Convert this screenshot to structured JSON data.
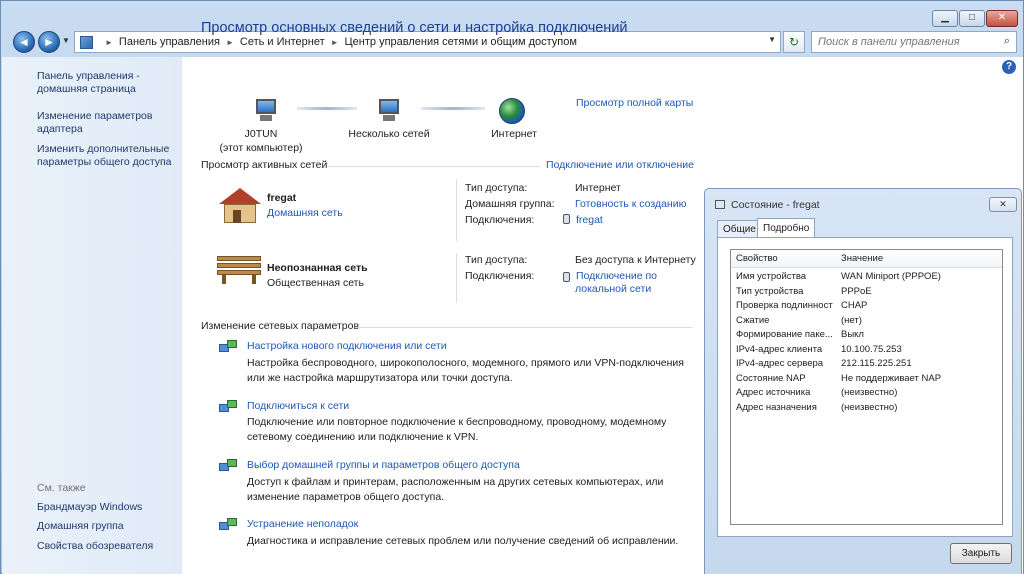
{
  "window": {
    "caption_buttons": {
      "minimize": "▁",
      "maximize": "□",
      "close": "✕"
    }
  },
  "navbar": {
    "back": "◄",
    "forward": "►",
    "breadcrumb": [
      "Панель управления",
      "Сеть и Интернет",
      "Центр управления сетями и общим доступом"
    ],
    "search_placeholder": "Поиск в панели управления"
  },
  "sidebar": {
    "items": [
      "Панель управления - домашняя страница",
      "Изменение параметров адаптера",
      "Изменить дополнительные параметры общего доступа"
    ],
    "see_also_title": "См. также",
    "see_also": [
      "Брандмауэр Windows",
      "Домашняя группа",
      "Свойства обозревателя"
    ]
  },
  "main": {
    "title": "Просмотр основных сведений о сети и настройка подключений",
    "map": {
      "computer_name": "J0TUN",
      "computer_sub": "(этот компьютер)",
      "middle": "Несколько сетей",
      "internet": "Интернет",
      "full_map_link": "Просмотр полной карты"
    },
    "active_networks_title": "Просмотр активных сетей",
    "connect_link": "Подключение или отключение",
    "networks": [
      {
        "name": "fregat",
        "type": "Домашняя сеть",
        "access_label": "Тип доступа:",
        "access_value": "Интернет",
        "homegroup_label": "Домашняя группа:",
        "homegroup_value": "Готовность к созданию",
        "connections_label": "Подключения:",
        "connections_value": "fregat"
      },
      {
        "name": "Неопознанная сеть",
        "type": "Общественная сеть",
        "access_label": "Тип доступа:",
        "access_value": "Без доступа к Интернету",
        "connections_label": "Подключения:",
        "connections_value": "Подключение по локальной сети"
      }
    ],
    "change_settings_title": "Изменение сетевых параметров",
    "tasks": [
      {
        "link": "Настройка нового подключения или сети",
        "desc": "Настройка беспроводного, широкополосного, модемного, прямого или VPN-подключения или же настройка маршрутизатора или точки доступа."
      },
      {
        "link": "Подключиться к сети",
        "desc": "Подключение или повторное подключение к беспроводному, проводному, модемному сетевому соединению или подключение к VPN."
      },
      {
        "link": "Выбор домашней группы и параметров общего доступа",
        "desc": "Доступ к файлам и принтерам, расположенным на других сетевых компьютерах, или изменение параметров общего доступа."
      },
      {
        "link": "Устранение неполадок",
        "desc": "Диагностика и исправление сетевых проблем или получение сведений об исправлении."
      }
    ]
  },
  "dialog": {
    "title": "Состояние - fregat",
    "close_glyph": "✕",
    "tabs": [
      "Общие",
      "Подробно"
    ],
    "grid_headers": [
      "Свойство",
      "Значение"
    ],
    "rows": [
      [
        "Имя устройства",
        "WAN Miniport (PPPOE)"
      ],
      [
        "Тип устройства",
        "PPPoE"
      ],
      [
        "Проверка подлинности",
        "CHAP"
      ],
      [
        "Сжатие",
        "(нет)"
      ],
      [
        "Формирование паке...",
        "Выкл"
      ],
      [
        "IPv4-адрес клиента",
        "10.100.75.253"
      ],
      [
        "IPv4-адрес сервера",
        "212.115.225.251"
      ],
      [
        "Состояние NAP",
        "Не поддерживает NAP"
      ],
      [
        "Адрес источника",
        "(неизвестно)"
      ],
      [
        "Адрес назначения",
        "(неизвестно)"
      ]
    ],
    "close_button": "Закрыть"
  }
}
